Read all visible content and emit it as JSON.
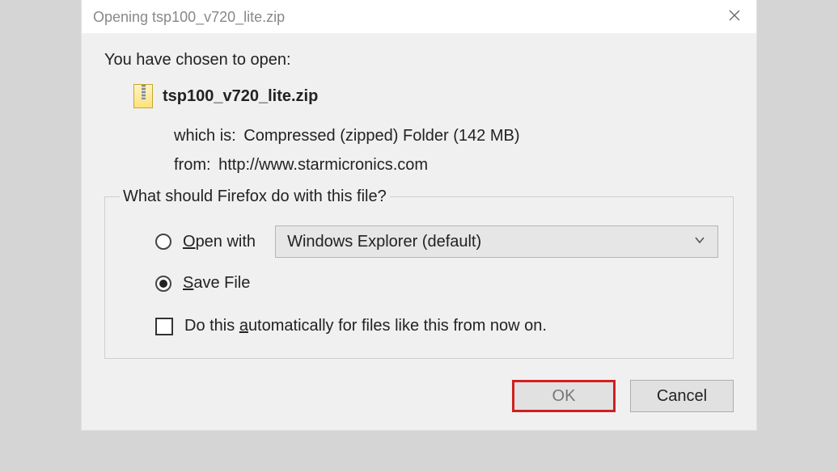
{
  "title": "Opening tsp100_v720_lite.zip",
  "prompt": "You have chosen to open:",
  "filename": "tsp100_v720_lite.zip",
  "meta": {
    "which_is_label": "which is:",
    "which_is_value": "Compressed (zipped) Folder (142 MB)",
    "from_label": "from:",
    "from_value": "http://www.starmicronics.com"
  },
  "group_legend": "What should Firefox do with this file?",
  "options": {
    "open_with_pre": "O",
    "open_with_post": "pen with",
    "combo_value": "Windows Explorer (default)",
    "save_file_pre": "S",
    "save_file_post": "ave File",
    "auto_pre": "Do this ",
    "auto_key": "a",
    "auto_post": "utomatically for files like this from now on."
  },
  "buttons": {
    "ok": "OK",
    "cancel": "Cancel"
  }
}
